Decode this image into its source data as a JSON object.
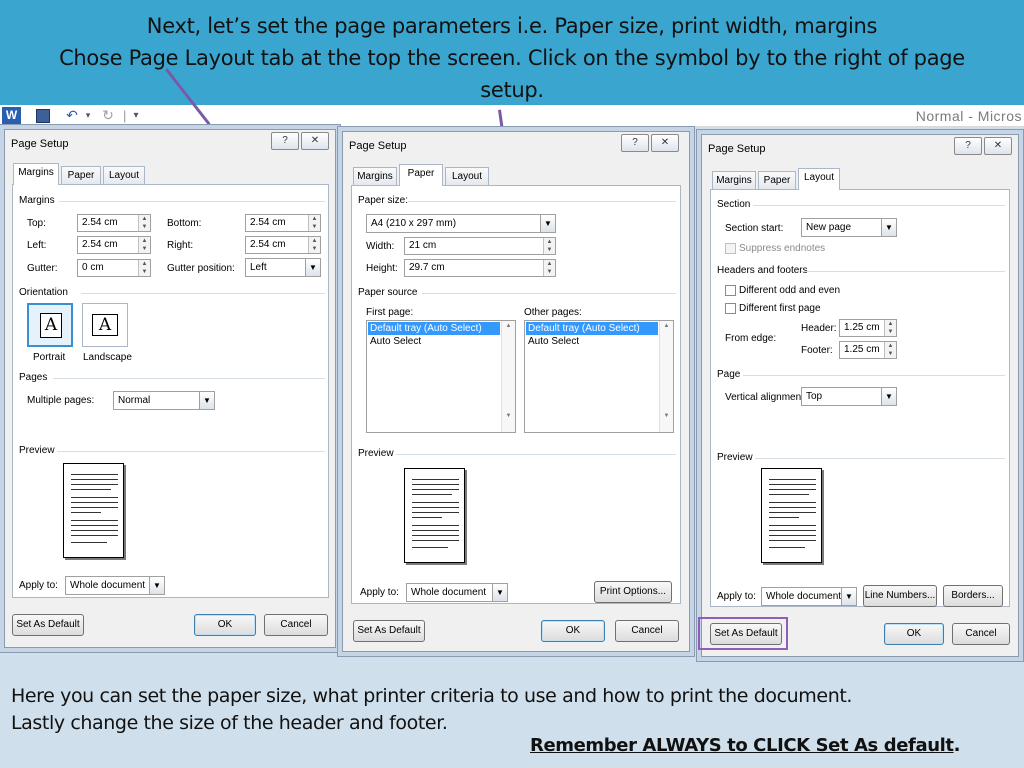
{
  "slide": {
    "top_line1": "Next, let’s set the page parameters i.e. Paper size, print width, margins",
    "top_line2": "Chose Page Layout  tab at the top the screen. Click on the symbol by to the right of page",
    "top_line3": "setup.",
    "bottom_line1": "Here you can set the paper size, what printer criteria to use and how to print the document.",
    "bottom_line2": "Lastly change the size of the header and footer.",
    "remember": "Remember ALWAYS to CLICK Set As default",
    "remember_suffix": ".",
    "colors": {
      "banner": "#3aa6cf",
      "footer": "#cfe0ec",
      "callout": "#7a5aa8"
    }
  },
  "word": {
    "logo": "W",
    "title": "Normal - Micros",
    "icons": [
      "save-icon",
      "undo-icon",
      "redo-icon"
    ]
  },
  "common": {
    "help": "?",
    "close": "✕",
    "tab_margins": "Margins",
    "tab_paper": "Paper",
    "tab_layout": "Layout",
    "apply_to_label": "Apply to:",
    "apply_to_value": "Whole document",
    "set_default": "Set As Default",
    "ok": "OK",
    "cancel": "Cancel",
    "preview": "Preview",
    "dialog_title": "Page Setup"
  },
  "margins_dialog": {
    "section_margins": "Margins",
    "top_label": "Top:",
    "top_value": "2.54 cm",
    "bottom_label": "Bottom:",
    "bottom_value": "2.54 cm",
    "left_label": "Left:",
    "left_value": "2.54 cm",
    "right_label": "Right:",
    "right_value": "2.54 cm",
    "gutter_label": "Gutter:",
    "gutter_value": "0 cm",
    "gutter_pos_label": "Gutter position:",
    "gutter_pos_value": "Left",
    "section_orientation": "Orientation",
    "portrait": "Portrait",
    "landscape": "Landscape",
    "section_pages": "Pages",
    "multiple_pages_label": "Multiple pages:",
    "multiple_pages_value": "Normal"
  },
  "paper_dialog": {
    "section_paper_size": "Paper size:",
    "paper_size_value": "A4 (210 x 297 mm)",
    "width_label": "Width:",
    "width_value": "21 cm",
    "height_label": "Height:",
    "height_value": "29.7 cm",
    "section_paper_source": "Paper source",
    "first_page_label": "First page:",
    "other_pages_label": "Other pages:",
    "tray_options": [
      "Default tray (Auto Select)",
      "Auto Select"
    ],
    "print_options": "Print Options..."
  },
  "layout_dialog": {
    "section_section": "Section",
    "section_start_label": "Section start:",
    "section_start_value": "New page",
    "suppress_endnotes": "Suppress endnotes",
    "section_headers": "Headers and footers",
    "diff_odd_even": "Different odd and even",
    "diff_first_page": "Different first page",
    "from_edge_label": "From edge:",
    "header_label": "Header:",
    "header_value": "1.25 cm",
    "footer_label": "Footer:",
    "footer_value": "1.25 cm",
    "section_page": "Page",
    "vertical_alignment_label": "Vertical alignment:",
    "vertical_alignment_value": "Top",
    "line_numbers": "Line Numbers...",
    "borders": "Borders..."
  }
}
